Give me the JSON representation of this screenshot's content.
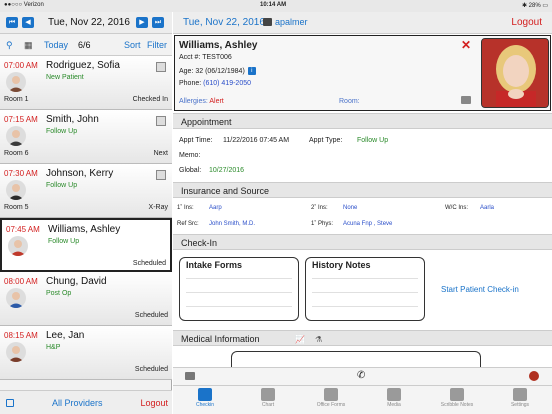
{
  "status_bar": {
    "carrier": "●●○○○ Verizon",
    "time": "10:14 AM",
    "battery": "✱ 28% ▭"
  },
  "left_pane": {
    "date_title": "Tue, Nov 22, 2016",
    "toolbar": {
      "today": "Today",
      "count": "6/6",
      "sort": "Sort",
      "filter": "Filter"
    },
    "appointments": [
      {
        "time": "07:00 AM",
        "name": "Rodriguez, Sofia",
        "type": "New Patient",
        "room": "Room 1",
        "status": "Checked In",
        "avatar_color": "#7a4a35"
      },
      {
        "time": "07:15 AM",
        "name": "Smith, John",
        "type": "Follow Up",
        "room": "Room 6",
        "status": "Next",
        "avatar_color": "#3a3a3a"
      },
      {
        "time": "07:30 AM",
        "name": "Johnson, Kerry",
        "type": "Follow Up",
        "room": "Room 5",
        "status": "X-Ray",
        "avatar_color": "#2a2a2a"
      },
      {
        "time": "07:45 AM",
        "name": "Williams, Ashley",
        "type": "Follow Up",
        "room": "",
        "status": "Scheduled",
        "avatar_color": "#c0392b"
      },
      {
        "time": "08:00 AM",
        "name": "Chung, David",
        "type": "Post Op",
        "room": "",
        "status": "Scheduled",
        "avatar_color": "#2b5aa8"
      },
      {
        "time": "08:15 AM",
        "name": "Lee, Jan",
        "type": "H&P",
        "room": "",
        "status": "Scheduled",
        "avatar_color": "#7a3d2a"
      }
    ],
    "bottom": {
      "all_providers": "All Providers",
      "logout": "Logout"
    }
  },
  "right_pane": {
    "date": "Tue, Nov 22, 2016",
    "user": "apalmer",
    "logout": "Logout",
    "patient": {
      "name": "Williams, Ashley",
      "acct": "Acct #:   TEST006",
      "age": "Age:  32 (06/12/1984)",
      "phone_label": "Phone:",
      "phone": "(610) 419-2050",
      "allergies_label": "Allergies:",
      "allergies_value": "Alert",
      "room_label": "Room:"
    },
    "sections": {
      "appointment": "Appointment",
      "insurance": "Insurance and Source",
      "checkin": "Check-In",
      "medical": "Medical Information"
    },
    "appointment": {
      "time_label": "Appt Time:",
      "time_value": "11/22/2016 07:45 AM",
      "type_label": "Appt Type:",
      "type_value": "Follow Up",
      "memo_label": "Memo:",
      "global_label": "Global:",
      "global_value": "10/27/2016"
    },
    "insurance": {
      "ins1_label": "1˚ Ins:",
      "ins1_value": "Aarp",
      "ins2_label": "2˚ Ins:",
      "ins2_value": "None",
      "wc_label": "W/C Ins:",
      "wc_value": "Aarla",
      "ref_label": "Ref Src:",
      "ref_value": "John Smith, M.D.",
      "phys_label": "1˚ Phys:",
      "phys_value": "Acuna Fnp , Steve"
    },
    "checkin": {
      "intake_forms": "Intake Forms",
      "history_notes": "History Notes",
      "start_checkin": "Start Patient Check-in"
    },
    "tabs": [
      {
        "label": "Checkin",
        "icon": "checkin-icon",
        "active": true
      },
      {
        "label": "Chart",
        "icon": "folder-icon",
        "active": false
      },
      {
        "label": "Office Forms",
        "icon": "forms-icon",
        "active": false
      },
      {
        "label": "Media",
        "icon": "monitor-icon",
        "active": false
      },
      {
        "label": "Scribble Notes",
        "icon": "pen-icon",
        "active": false
      },
      {
        "label": "Settings",
        "icon": "gear-icon",
        "active": false
      }
    ]
  },
  "colors": {
    "accent": "#1a73c9",
    "alert": "#d32020",
    "success": "#2a8a2a"
  }
}
